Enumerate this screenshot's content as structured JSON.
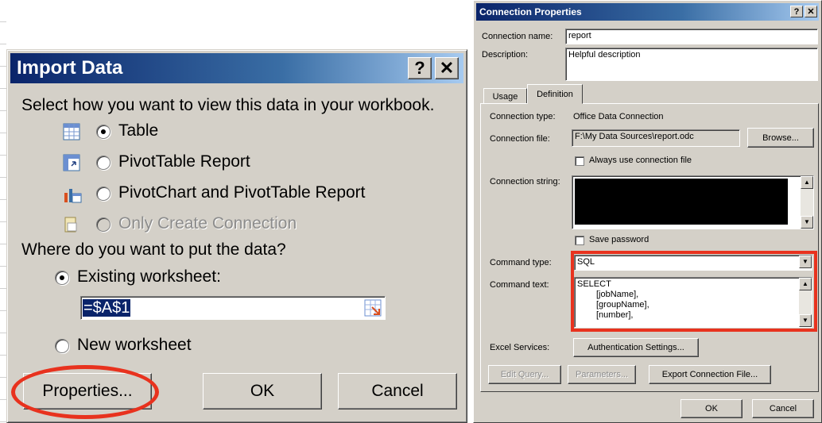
{
  "import_dialog": {
    "title": "Import Data",
    "help_button": "?",
    "close_button": "✕",
    "view_prompt": "Select how you want to view this data in your workbook.",
    "view_options": [
      {
        "label": "Table",
        "icon": "table-icon",
        "selected": true,
        "enabled": true
      },
      {
        "label": "PivotTable Report",
        "icon": "pivottable-icon",
        "selected": false,
        "enabled": true
      },
      {
        "label": "PivotChart and PivotTable Report",
        "icon": "pivotchart-icon",
        "selected": false,
        "enabled": true
      },
      {
        "label": "Only Create Connection",
        "icon": "connection-icon",
        "selected": false,
        "enabled": false
      }
    ],
    "location_prompt": "Where do you want to put the data?",
    "existing_worksheet_label": "Existing worksheet:",
    "existing_worksheet_selected": true,
    "cell_reference": "=$A$1",
    "new_worksheet_label": "New worksheet",
    "properties_button": "Properties...",
    "ok_button": "OK",
    "cancel_button": "Cancel"
  },
  "connection_dialog": {
    "title": "Connection Properties",
    "help_button": "?",
    "close_button": "✕",
    "connection_name_label": "Connection name:",
    "connection_name_value": "report",
    "description_label": "Description:",
    "description_value": "Helpful description",
    "tabs": [
      {
        "label": "Usage",
        "active": false
      },
      {
        "label": "Definition",
        "active": true
      }
    ],
    "connection_type_label": "Connection type:",
    "connection_type_value": "Office Data Connection",
    "connection_file_label": "Connection file:",
    "connection_file_value": "F:\\My Data Sources\\report.odc",
    "browse_button": "Browse...",
    "always_use_file_label": "Always use connection file",
    "always_use_file_checked": false,
    "connection_string_label": "Connection string:",
    "save_password_label": "Save password",
    "save_password_checked": false,
    "command_type_label": "Command type:",
    "command_type_value": "SQL",
    "command_text_label": "Command text:",
    "command_text_lines": [
      "SELECT",
      "[jobName],",
      "[groupName],",
      "[number],"
    ],
    "excel_services_label": "Excel Services:",
    "authentication_button": "Authentication Settings...",
    "edit_query_button": "Edit Query...",
    "parameters_button": "Parameters...",
    "export_button": "Export Connection File...",
    "ok_button": "OK",
    "cancel_button": "Cancel"
  },
  "colors": {
    "dialog_face": "#d4d0c8",
    "title_bar": "#0a246a",
    "highlight": "#e8321e",
    "selection": "#0a246a"
  }
}
